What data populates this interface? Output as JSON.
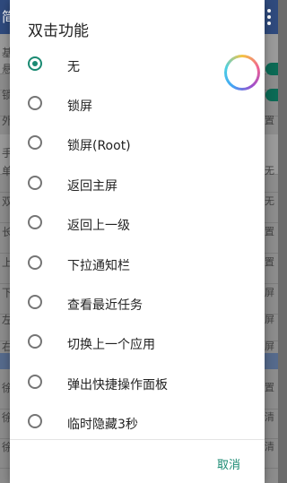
{
  "background": {
    "header_title": "简",
    "rows": [
      {
        "label": "基",
        "right": ""
      },
      {
        "label": "悬",
        "right": ""
      },
      {
        "label": "锁",
        "right": ""
      },
      {
        "label": "外",
        "right": "置"
      },
      {
        "label": "手",
        "right": ""
      },
      {
        "label": "单",
        "right": "无"
      },
      {
        "label": "双",
        "right": "无"
      },
      {
        "label": "长",
        "right": "置"
      },
      {
        "label": "上",
        "right": "置"
      },
      {
        "label": "下",
        "right": "屏"
      },
      {
        "label": "左",
        "right": "屏"
      },
      {
        "label": "右",
        "right": "屏"
      },
      {
        "label": "徐",
        "right": "置"
      },
      {
        "label": "徐",
        "right": "清"
      },
      {
        "label": "徐",
        "right": "清"
      }
    ]
  },
  "dialog": {
    "title": "双击功能",
    "options": [
      {
        "label": "无",
        "checked": true
      },
      {
        "label": "锁屏",
        "checked": false
      },
      {
        "label": "锁屏(Root)",
        "checked": false
      },
      {
        "label": "返回主屏",
        "checked": false
      },
      {
        "label": "返回上一级",
        "checked": false
      },
      {
        "label": "下拉通知栏",
        "checked": false
      },
      {
        "label": "查看最近任务",
        "checked": false
      },
      {
        "label": "切换上一个应用",
        "checked": false
      },
      {
        "label": "弹出快捷操作面板",
        "checked": false
      },
      {
        "label": "临时隐藏3秒",
        "checked": false
      }
    ],
    "cancel_label": "取消"
  },
  "colors": {
    "accent": "#1a8a72",
    "header": "#2f4a7d"
  }
}
